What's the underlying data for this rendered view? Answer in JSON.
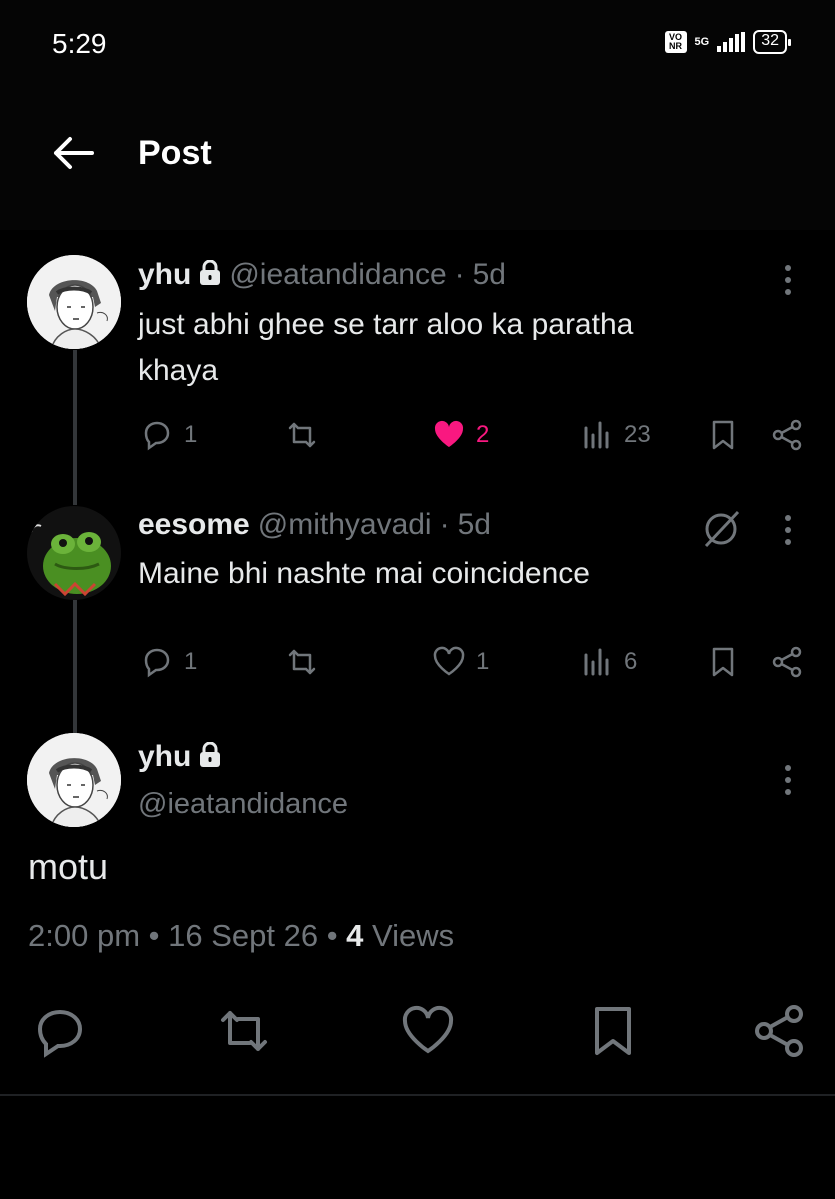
{
  "status_bar": {
    "time": "5:29",
    "volte": "Vo NR",
    "network": "5G",
    "battery": "32"
  },
  "header": {
    "title": "Post"
  },
  "thread": [
    {
      "name": "yhu",
      "handle": "@ieatandidance",
      "age": "5d",
      "text_line1": "just abhi ghee se tarr aloo ka paratha",
      "text_line2": "khaya",
      "replies": "1",
      "likes": "2",
      "views": "23"
    },
    {
      "name": "eesome",
      "handle": "@mithyavadi",
      "age": "5d",
      "text": "Maine bhi nashte mai coincidence",
      "replies": "1",
      "likes": "1",
      "views": "6"
    }
  ],
  "main_post": {
    "name": "yhu",
    "handle": "@ieatandidance",
    "text": "motu",
    "time": "2:00 pm",
    "date": "16 Sept 26",
    "views_count": "4",
    "views_label": "Views"
  },
  "colors": {
    "like_pink": "#f91880",
    "muted": "#71767b",
    "text": "#e7e9ea"
  }
}
